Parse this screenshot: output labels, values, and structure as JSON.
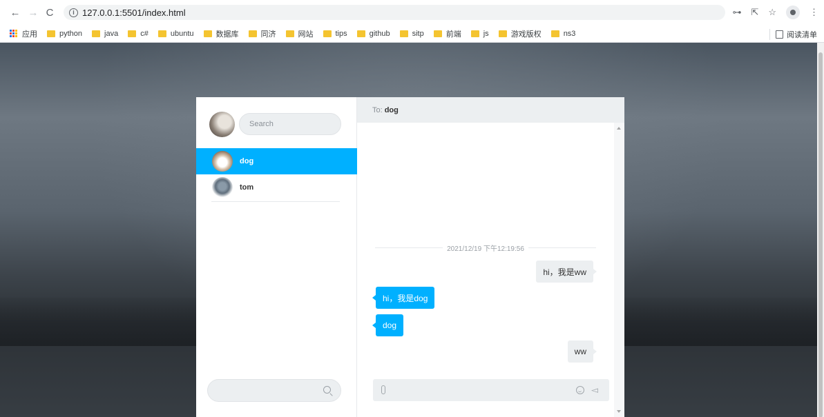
{
  "browser": {
    "url": "127.0.0.1:5501/index.html",
    "bookmarks": [
      "应用",
      "python",
      "java",
      "c#",
      "ubuntu",
      "数据库",
      "同济",
      "网站",
      "tips",
      "github",
      "sitp",
      "前端",
      "js",
      "游戏版权",
      "ns3"
    ],
    "reading_list": "阅读清单"
  },
  "chat": {
    "search_placeholder": "Search",
    "contacts": [
      {
        "name": "dog",
        "active": true
      },
      {
        "name": "tom",
        "active": false
      }
    ],
    "header": {
      "to_label": "To:",
      "to_name": "dog"
    },
    "timestamp": "2021/12/19 下午12:19:56",
    "messages": [
      {
        "from": "me",
        "text": "hi，我是ww"
      },
      {
        "from": "them",
        "text": "hi，我是dog"
      },
      {
        "from": "them",
        "text": "dog"
      },
      {
        "from": "me",
        "text": "ww"
      }
    ]
  },
  "colors": {
    "accent": "#00b0ff",
    "panel": "#eceff1"
  }
}
